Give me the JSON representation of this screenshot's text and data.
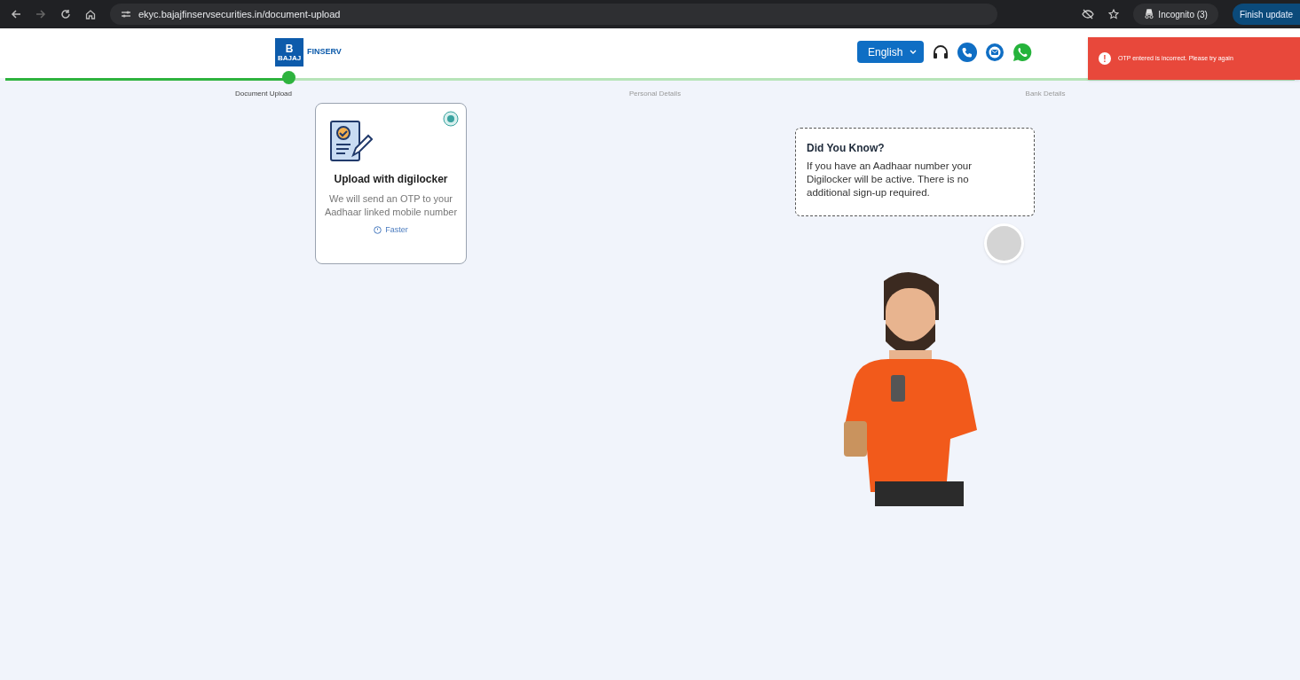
{
  "browser": {
    "url": "ekyc.bajajfinservsecurities.in/document-upload",
    "profile": "Incognito (3)",
    "update_button": "Finish update"
  },
  "header": {
    "logo": {
      "mark": "B",
      "brand": "BAJAJ",
      "product": "FINSERV"
    },
    "language": "English"
  },
  "toast": {
    "message": "OTP entered is incorrect. Please try again",
    "icon": "!"
  },
  "progress": {
    "level": 0.22,
    "steps": [
      {
        "label": "Document Upload",
        "selected": true
      },
      {
        "label": "Personal Details",
        "selected": false
      },
      {
        "label": "Bank Details",
        "selected": false
      }
    ]
  },
  "option_card": {
    "title": "Upload with digilocker",
    "description": "We will send an OTP to your Aadhaar linked mobile number",
    "tag": "Faster"
  },
  "tip": {
    "title": "Did You Know?",
    "text": "If you have an Aadhaar number your Digilocker will be active. There is no additional sign-up required."
  }
}
